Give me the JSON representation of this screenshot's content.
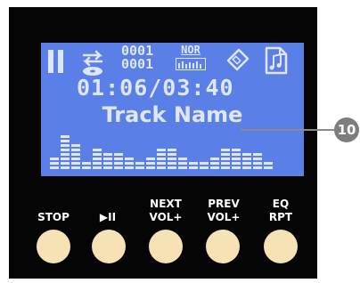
{
  "display": {
    "counter_top": "0001",
    "counter_bottom": "0001",
    "eq_mode": "NOR",
    "time": "01:06/03:40",
    "track_name": "Track Name",
    "play_state_icon": "pause-icon",
    "repeat_icon": "repeat-disc-icon",
    "tag_icon": "tag-icon",
    "music_icon": "music-note-icon",
    "spectrum_levels": [
      3,
      8,
      6,
      2,
      5,
      4,
      4,
      3,
      2,
      3,
      5,
      5,
      3,
      2,
      2,
      3,
      5,
      5,
      4,
      4,
      2
    ]
  },
  "callout": {
    "number": "10"
  },
  "controls": [
    {
      "line1": "STOP",
      "line2": ""
    },
    {
      "line1": "▶II",
      "line2": ""
    },
    {
      "line1": "NEXT",
      "line2": "VOL+"
    },
    {
      "line1": "PREV",
      "line2": "VOL+"
    },
    {
      "line1": "EQ",
      "line2": "RPT"
    }
  ],
  "colors": {
    "panel": "#050505",
    "screen": "#5a7fe6",
    "lcd_text": "#dfe7ff",
    "button": "#f7e2b5",
    "callout": "#7d7d7d"
  }
}
